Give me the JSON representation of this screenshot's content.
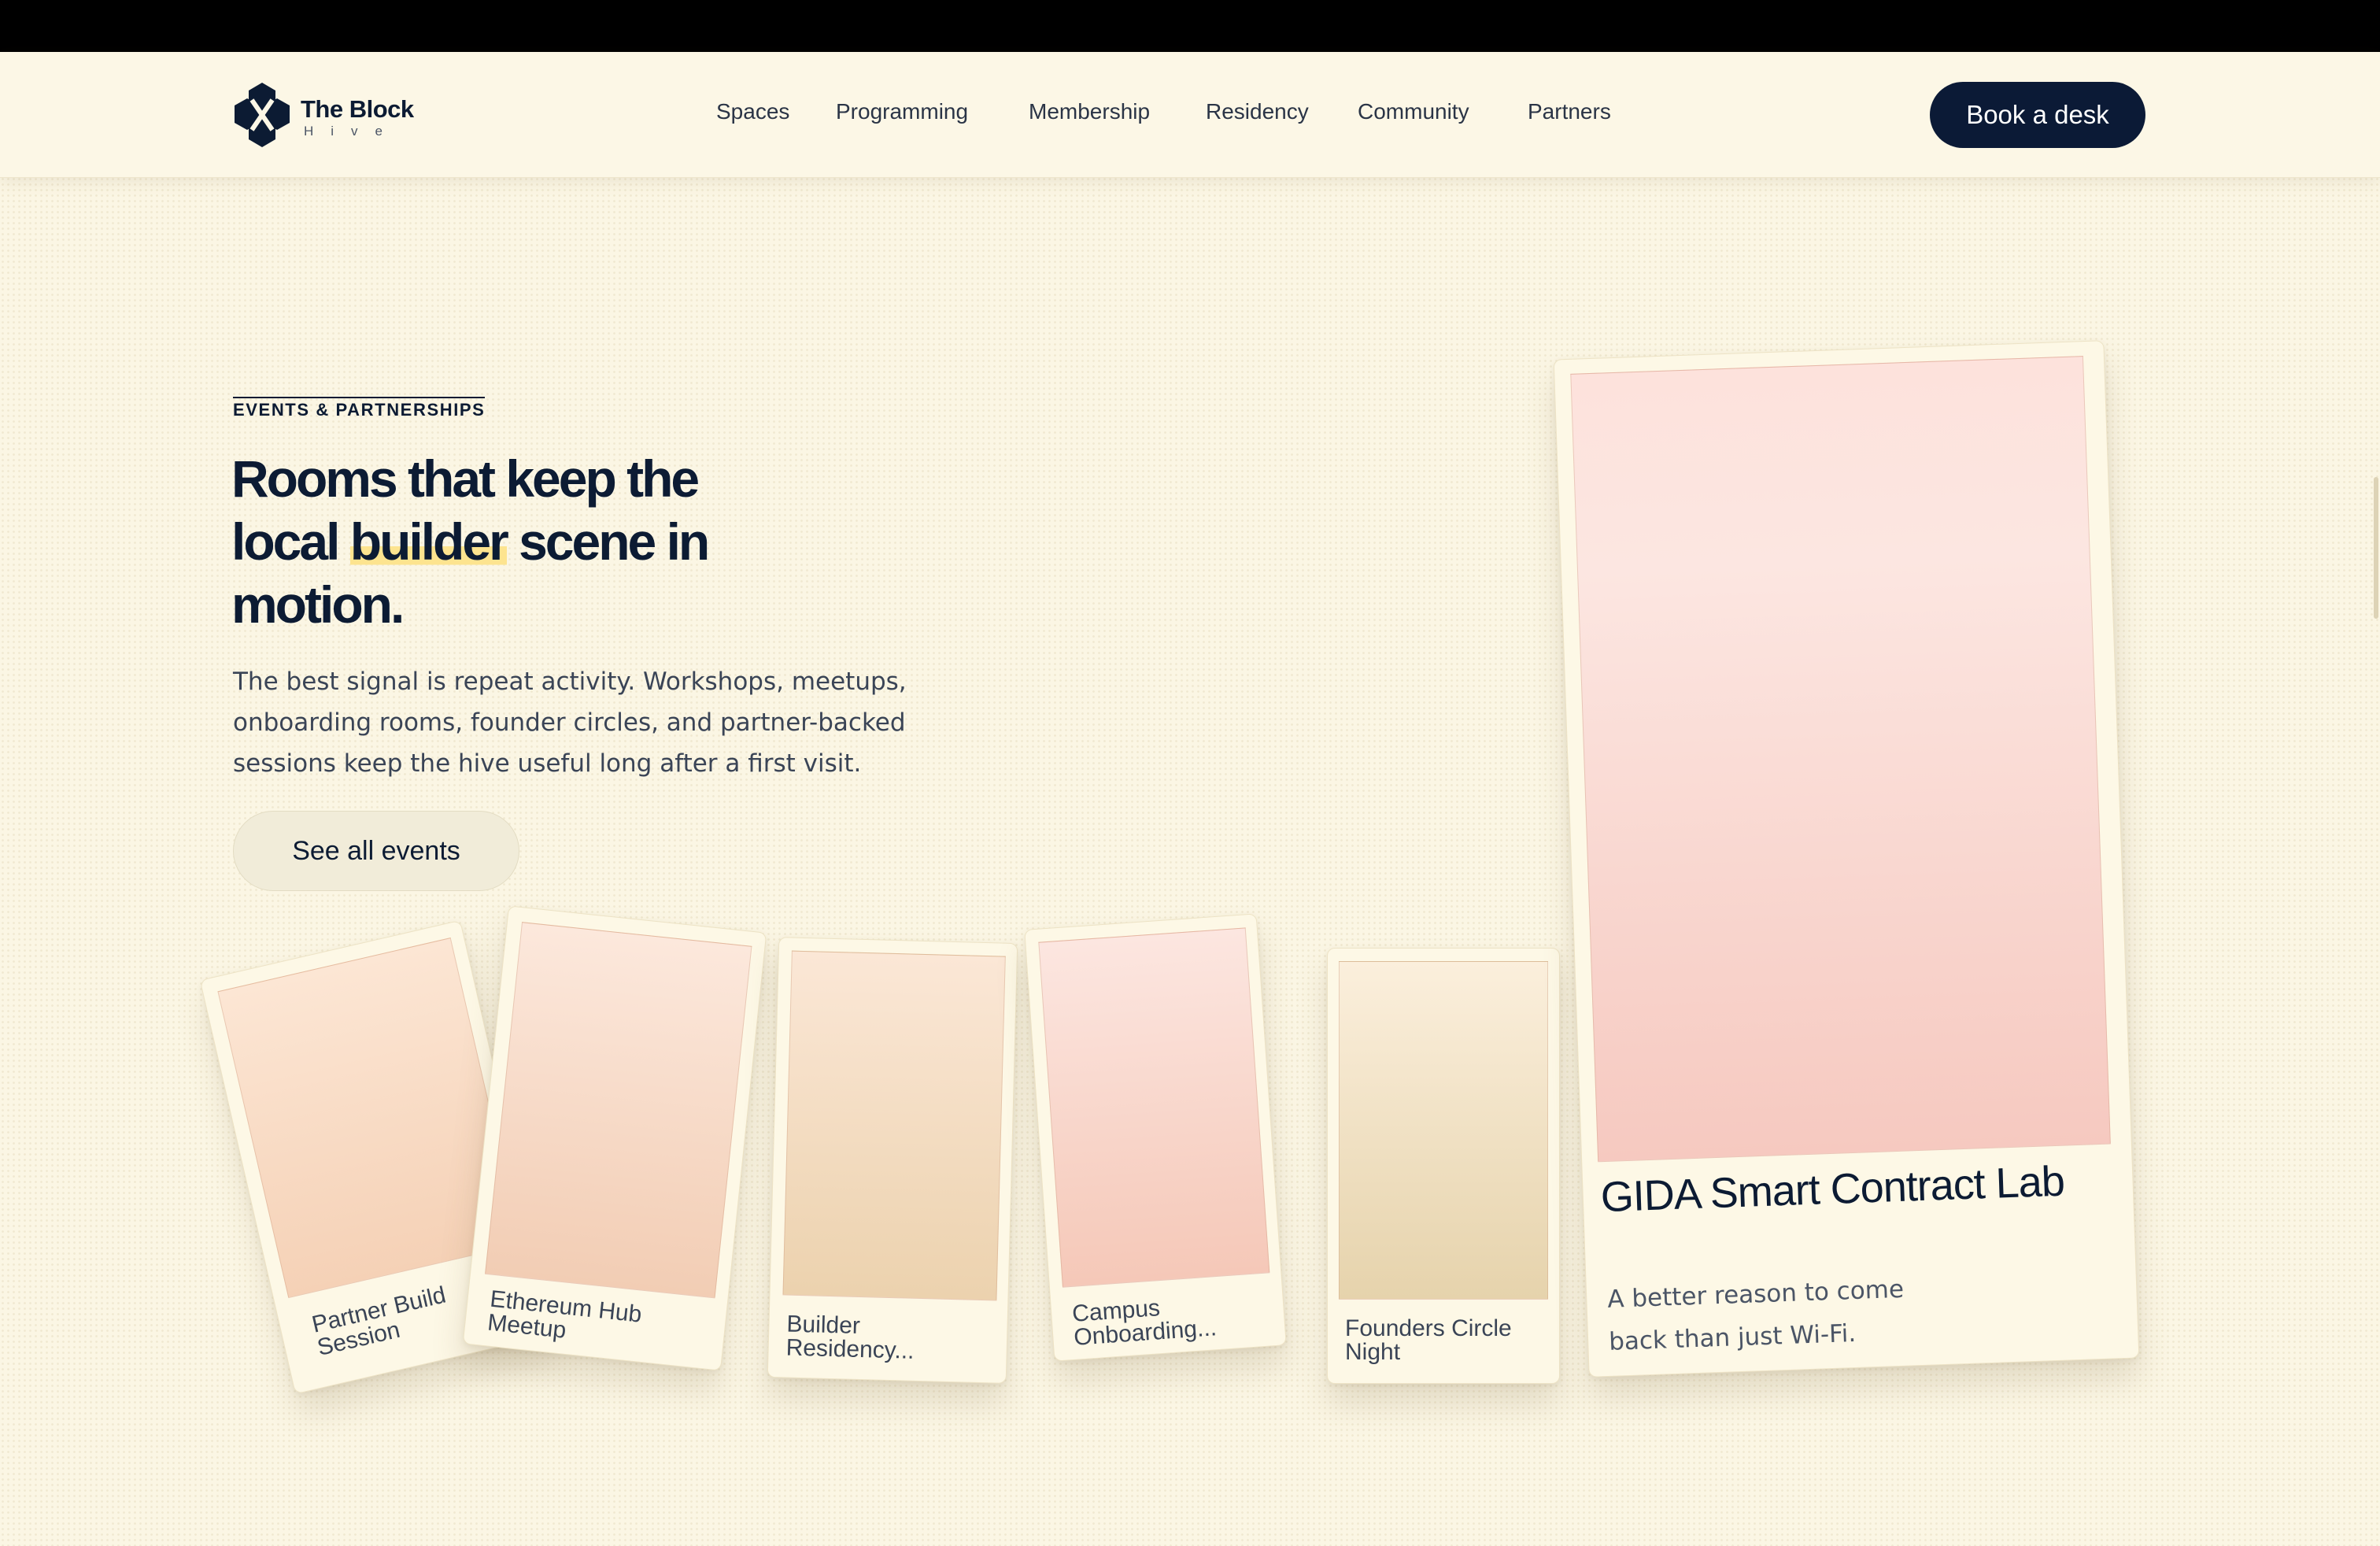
{
  "brand": {
    "name": "The Block",
    "sub": "Hive"
  },
  "nav": {
    "items": [
      {
        "label": "Spaces"
      },
      {
        "label": "Programming"
      },
      {
        "label": "Membership"
      },
      {
        "label": "Residency"
      },
      {
        "label": "Community"
      },
      {
        "label": "Partners"
      }
    ],
    "cta": "Book a desk"
  },
  "hero": {
    "eyebrow": "EVENTS & PARTNERSHIPS",
    "headline_part1": "Rooms that keep the local ",
    "headline_highlight": "builder",
    "headline_part2": " scene in motion.",
    "lead": "The best signal is repeat activity. Workshops, meetups, onboarding rooms, founder circles, and partner-backed sessions keep the hive useful long after a first visit.",
    "button": "See all events"
  },
  "cards": [
    {
      "caption": "Partner Build Session"
    },
    {
      "caption": "Ethereum Hub Meetup"
    },
    {
      "caption": "Builder Residency..."
    },
    {
      "caption": "Campus Onboarding..."
    },
    {
      "caption": "Founders Circle Night"
    }
  ],
  "featured": {
    "title": "GIDA Smart Contract Lab",
    "subtitle": "A better reason to come back than just Wi-Fi."
  },
  "colors": {
    "background": "#fbf6e4",
    "navy": "#0b1a36",
    "highlight": "#fde48f",
    "card": "#fdf8e6"
  }
}
